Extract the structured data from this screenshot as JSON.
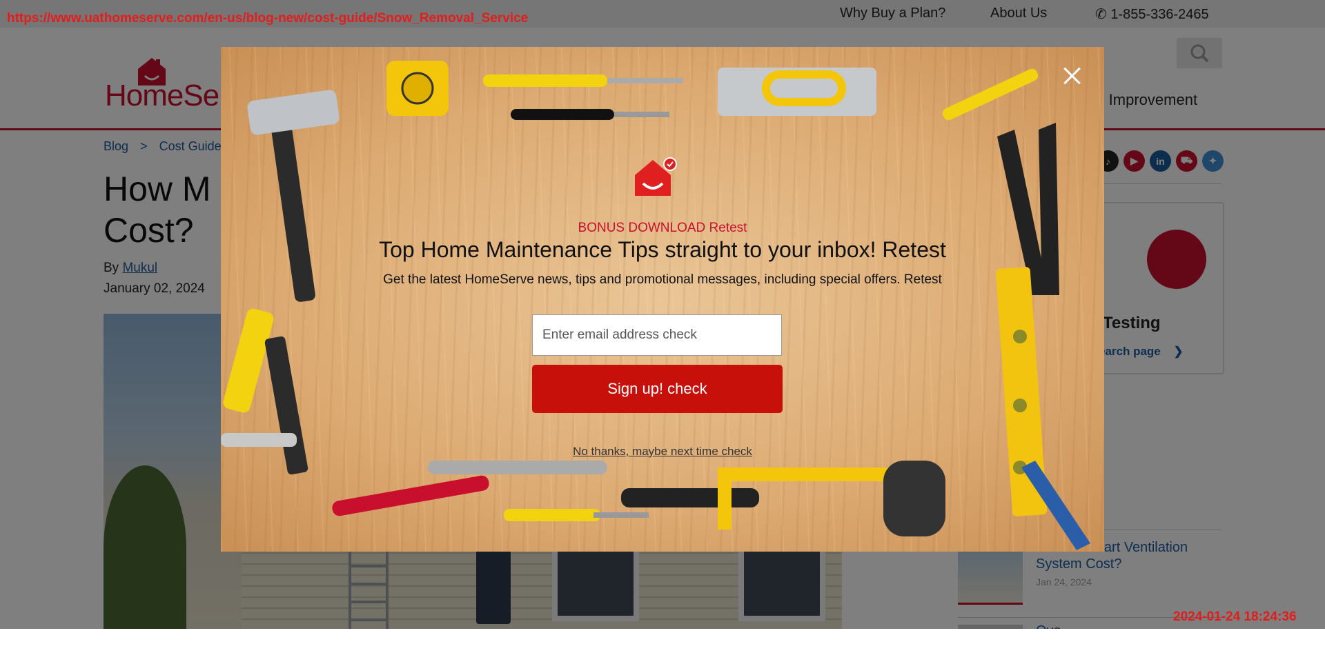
{
  "browser": {
    "url": "https://www.uathomeserve.com/en-us/blog-new/cost-guide/Snow_Removal_Service",
    "timestamp": "2024-01-24 18:24:36"
  },
  "utility_nav": {
    "why_buy": "Why Buy a Plan?",
    "about": "About Us",
    "phone": "1-855-336-2465",
    "phone_icon": "phone-icon"
  },
  "header": {
    "logo_text": "HomeServ",
    "nav_partial": "me Improvement",
    "search_icon": "search-icon"
  },
  "article": {
    "breadcrumb": [
      "Blog",
      ">",
      "Cost Guide",
      ">"
    ],
    "title_line1": "How M",
    "title_line2": "Cost?",
    "by_label": "By",
    "author": "Mukul",
    "date": "January 02, 2024"
  },
  "sidebar": {
    "social": [
      {
        "icon": "tiktok-icon",
        "glyph": "♪",
        "color": "#222222"
      },
      {
        "icon": "youtube-icon",
        "glyph": "▶",
        "color": "#c8102e"
      },
      {
        "icon": "linkedin-icon",
        "glyph": "in",
        "color": "#1a5b9e"
      },
      {
        "icon": "truck-icon",
        "glyph": "⛟",
        "color": "#c8102e"
      },
      {
        "icon": "twitter-icon",
        "glyph": "✦",
        "color": "#3f8fd2"
      }
    ],
    "card_title": "r Testing",
    "card_link": "earch page",
    "related": [
      {
        "title": "Does a Smart Ventilation System Cost?",
        "date": "Jan 24, 2024"
      },
      {
        "title": "Ovo",
        "date": ""
      }
    ]
  },
  "modal": {
    "bonus_label": "BONUS DOWNLOAD Retest",
    "headline": "Top Home Maintenance Tips straight to your inbox! Retest",
    "subhead": "Get the latest HomeServe news, tips and promotional messages, including special offers. Retest",
    "email_placeholder": "Enter email address check",
    "signup_label": "Sign up! check",
    "decline_label": "No thanks, maybe next time check",
    "close_icon": "close-icon",
    "brand_icon": "homeserve-house-icon"
  },
  "colors": {
    "brand_red": "#c8102e",
    "button_red": "#c8100a",
    "link_blue": "#1a5b9e",
    "overlay_text_red": "#e41c1c"
  }
}
